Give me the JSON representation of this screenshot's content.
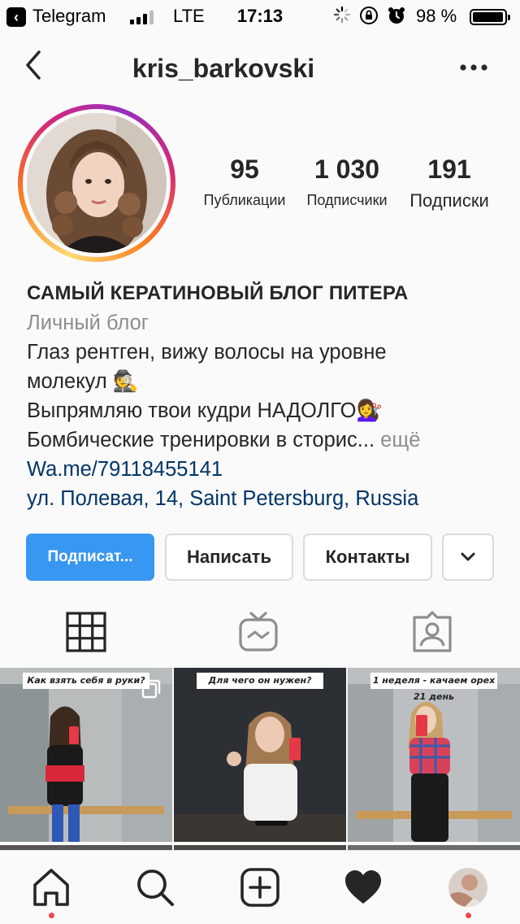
{
  "status_bar": {
    "app": "Telegram",
    "network": "LTE",
    "time": "17:13",
    "battery_text": "98 %",
    "battery_level": 0.98,
    "signal_bars_filled": 3,
    "signal_bars_total": 4
  },
  "header": {
    "username": "kris_barkovski"
  },
  "stats": {
    "posts_count": "95",
    "posts_label": "Публикации",
    "followers_count": "1 030",
    "followers_label": "Подписчики",
    "following_count": "191",
    "following_label": "Подписки"
  },
  "bio": {
    "name": "САМЫЙ КЕРАТИНОВЫЙ БЛОГ ПИТЕРА",
    "category": "Личный блог",
    "line1": "Глаз рентген, вижу волосы на уровне",
    "line2": "молекул 🕵️",
    "line3": "Выпрямляю твои кудри НАДОЛГО💇‍♀️",
    "line4": "Бомбические тренировки в сторис...",
    "more": "ещё",
    "link": "Wa.me/79118455141",
    "address": "ул. Полевая, 14, Saint Petersburg, Russia"
  },
  "buttons": {
    "follow": "Подписат...",
    "message": "Написать",
    "contacts": "Контакты"
  },
  "posts": [
    {
      "caption": "Как взять себя в руки?"
    },
    {
      "caption": "Для чего он нужен?"
    },
    {
      "caption": "1 неделя - качаем орех 21 день"
    }
  ],
  "colors": {
    "accent_blue": "#3897f0",
    "link_blue": "#003569",
    "notification_red": "#ed4956",
    "text_gray": "#8e8e8e"
  },
  "icons": {
    "tab_grid": "grid-icon",
    "tab_igtv": "igtv-icon",
    "tab_tagged": "tagged-icon",
    "nav_home": "home-icon",
    "nav_search": "search-icon",
    "nav_add": "add-icon",
    "nav_activity": "heart-icon",
    "nav_profile": "profile-avatar"
  }
}
